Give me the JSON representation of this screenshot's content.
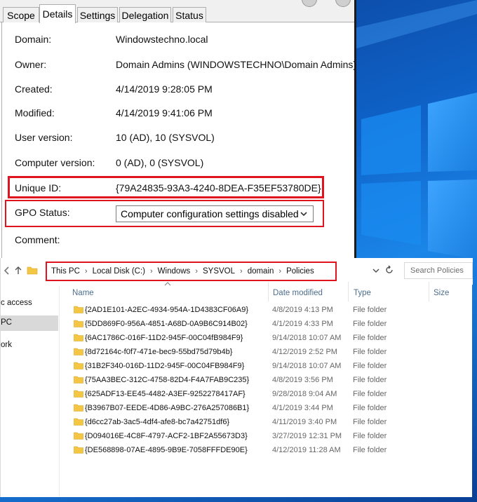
{
  "gpo_dialog": {
    "tabs": [
      "Scope",
      "Details",
      "Settings",
      "Delegation",
      "Status"
    ],
    "active_tab": "Details",
    "details": {
      "domain_label": "Domain:",
      "domain_value": "Windowstechno.local",
      "owner_label": "Owner:",
      "owner_value": "Domain Admins (WINDOWSTECHNO\\Domain Admins)",
      "created_label": "Created:",
      "created_value": "4/14/2019 9:28:05 PM",
      "modified_label": "Modified:",
      "modified_value": "4/14/2019 9:41:06 PM",
      "user_version_label": "User version:",
      "user_version_value": "10 (AD), 10 (SYSVOL)",
      "computer_version_label": "Computer version:",
      "computer_version_value": "0 (AD), 0 (SYSVOL)",
      "unique_id_label": "Unique ID:",
      "unique_id_value": "{79A24835-93A3-4240-8DEA-F35EF53780DE}",
      "gpo_status_label": "GPO Status:",
      "gpo_status_value": "Computer configuration settings disabled",
      "comment_label": "Comment:"
    }
  },
  "explorer": {
    "breadcrumb": [
      "This PC",
      "Local Disk (C:)",
      "Windows",
      "SYSVOL",
      "domain",
      "Policies"
    ],
    "search_placeholder": "Search Policies",
    "nav_items": [
      "c access",
      "PC",
      "ork"
    ],
    "columns": {
      "name": "Name",
      "date": "Date modified",
      "type": "Type",
      "size": "Size"
    },
    "files": [
      {
        "name": "{2AD1E101-A2EC-4934-954A-1D4383CF06A9}",
        "date": "4/8/2019 4:13 PM",
        "type": "File folder"
      },
      {
        "name": "{5DD869F0-956A-4851-A68D-0A9B6C914B02}",
        "date": "4/1/2019 4:33 PM",
        "type": "File folder"
      },
      {
        "name": "{6AC1786C-016F-11D2-945F-00C04fB984F9}",
        "date": "9/14/2018 10:07 AM",
        "type": "File folder"
      },
      {
        "name": "{8d72164c-f0f7-471e-bec9-55bd75d79b4b}",
        "date": "4/12/2019 2:52 PM",
        "type": "File folder"
      },
      {
        "name": "{31B2F340-016D-11D2-945F-00C04FB984F9}",
        "date": "9/14/2018 10:07 AM",
        "type": "File folder"
      },
      {
        "name": "{75AA3BEC-312C-4758-82D4-F4A7FAB9C235}",
        "date": "4/8/2019 3:56 PM",
        "type": "File folder"
      },
      {
        "name": "{625ADF13-EE45-4482-A3EF-9252278417AF}",
        "date": "9/28/2018 9:04 AM",
        "type": "File folder"
      },
      {
        "name": "{B3967B07-EEDE-4D86-A9BC-276A257086B1}",
        "date": "4/1/2019 3:44 PM",
        "type": "File folder"
      },
      {
        "name": "{d6cc27ab-3ac5-4df4-afe8-bc7a42751df6}",
        "date": "4/11/2019 3:40 PM",
        "type": "File folder"
      },
      {
        "name": "{D094016E-4C8F-4797-ACF2-1BF2A55673D3}",
        "date": "3/27/2019 12:31 PM",
        "type": "File folder"
      },
      {
        "name": "{DE568898-07AE-4895-9B9E-7058FFFDE90E}",
        "date": "4/12/2019 11:28 AM",
        "type": "File folder"
      }
    ]
  },
  "colors": {
    "highlight_red": "#e0141e",
    "desktop_blue": "#0f63c9",
    "folder_yellow": "#f3c644"
  },
  "icons": [
    "folder-icon",
    "back-arrow-icon",
    "up-arrow-icon",
    "chevron-down-icon",
    "refresh-icon",
    "sort-up-icon",
    "windows-logo-icon"
  ]
}
